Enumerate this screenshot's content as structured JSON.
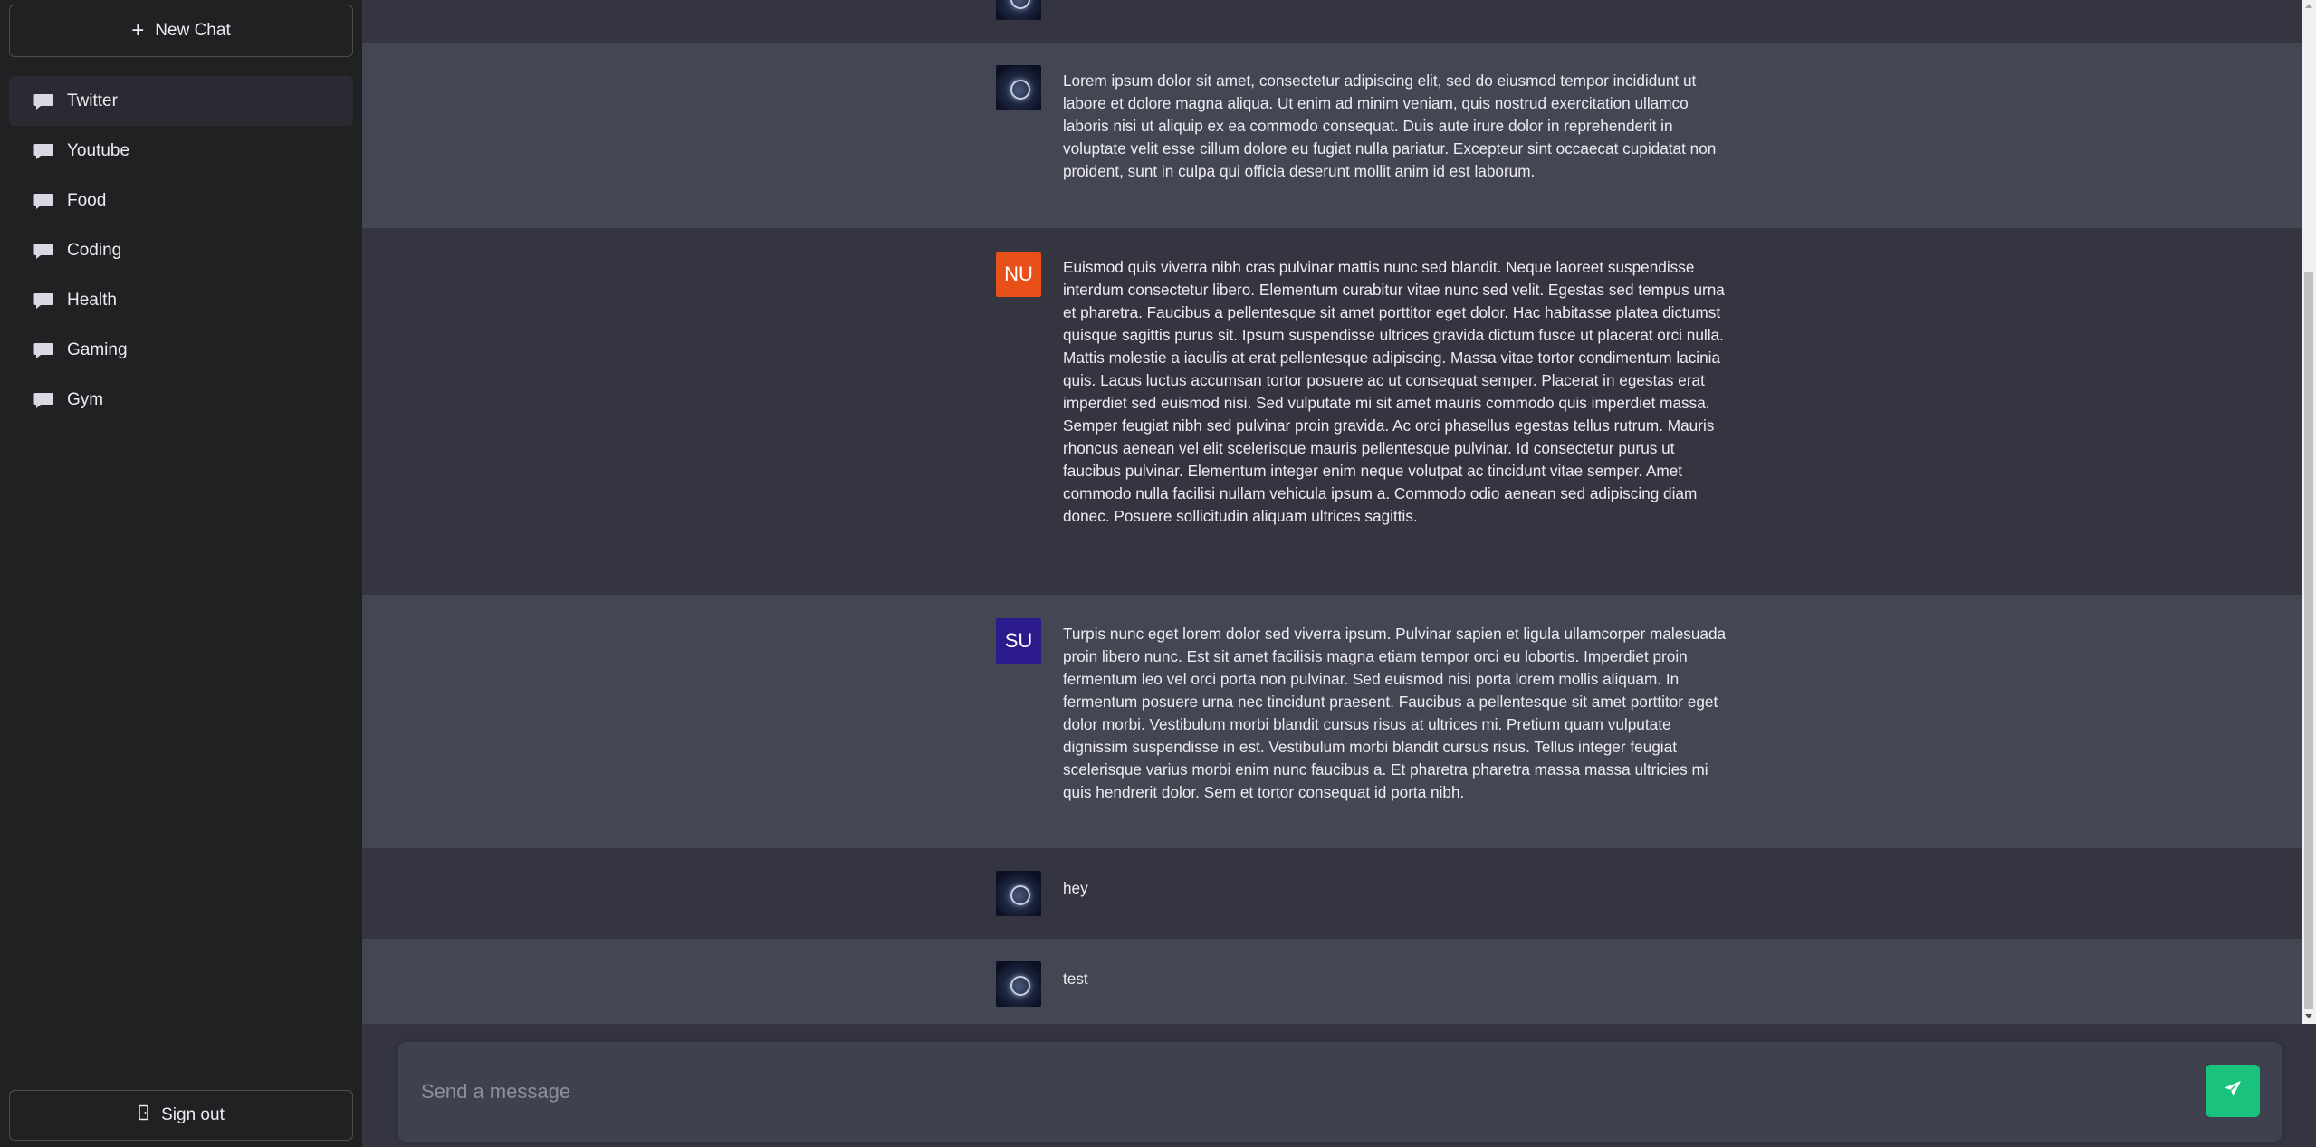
{
  "sidebar": {
    "new_chat_label": "New Chat",
    "items": [
      {
        "label": "Twitter"
      },
      {
        "label": "Youtube"
      },
      {
        "label": "Food"
      },
      {
        "label": "Coding"
      },
      {
        "label": "Health"
      },
      {
        "label": "Gaming"
      },
      {
        "label": "Gym"
      }
    ],
    "sign_out_label": "Sign out"
  },
  "messages": [
    {
      "avatar": "",
      "avatar_type": "image",
      "text": ""
    },
    {
      "avatar": "",
      "avatar_type": "image",
      "text": "Lorem ipsum dolor sit amet, consectetur adipiscing elit, sed do eiusmod tempor incididunt ut labore et dolore magna aliqua. Ut enim ad minim veniam, quis nostrud exercitation ullamco laboris nisi ut aliquip ex ea commodo consequat. Duis aute irure dolor in reprehenderit in voluptate velit esse cillum dolore eu fugiat nulla pariatur. Excepteur sint occaecat cupidatat non proident, sunt in culpa qui officia deserunt mollit anim id est laborum."
    },
    {
      "avatar": "NU",
      "avatar_type": "initials",
      "text": "Euismod quis viverra nibh cras pulvinar mattis nunc sed blandit. Neque laoreet suspendisse interdum consectetur libero. Elementum curabitur vitae nunc sed velit. Egestas sed tempus urna et pharetra. Faucibus a pellentesque sit amet porttitor eget dolor. Hac habitasse platea dictumst quisque sagittis purus sit. Ipsum suspendisse ultrices gravida dictum fusce ut placerat orci nulla. Mattis molestie a iaculis at erat pellentesque adipiscing. Massa vitae tortor condimentum lacinia quis. Lacus luctus accumsan tortor posuere ac ut consequat semper. Placerat in egestas erat imperdiet sed euismod nisi. Sed vulputate mi sit amet mauris commodo quis imperdiet massa. Semper feugiat nibh sed pulvinar proin gravida. Ac orci phasellus egestas tellus rutrum. Mauris rhoncus aenean vel elit scelerisque mauris pellentesque pulvinar. Id consectetur purus ut faucibus pulvinar. Elementum integer enim neque volutpat ac tincidunt vitae semper. Amet commodo nulla facilisi nullam vehicula ipsum a. Commodo odio aenean sed adipiscing diam donec. Posuere sollicitudin aliquam ultrices sagittis."
    },
    {
      "avatar": "SU",
      "avatar_type": "initials",
      "text": "Turpis nunc eget lorem dolor sed viverra ipsum. Pulvinar sapien et ligula ullamcorper malesuada proin libero nunc. Est sit amet facilisis magna etiam tempor orci eu lobortis. Imperdiet proin fermentum leo vel orci porta non pulvinar. Sed euismod nisi porta lorem mollis aliquam. In fermentum posuere urna nec tincidunt praesent. Faucibus a pellentesque sit amet porttitor eget dolor morbi. Vestibulum morbi blandit cursus risus at ultrices mi. Pretium quam vulputate dignissim suspendisse in est. Vestibulum morbi blandit cursus risus. Tellus integer feugiat scelerisque varius morbi enim nunc faucibus a. Et pharetra pharetra massa massa ultricies mi quis hendrerit dolor. Sem et tortor consequat id porta nibh."
    },
    {
      "avatar": "",
      "avatar_type": "image",
      "text": "hey"
    },
    {
      "avatar": "",
      "avatar_type": "image",
      "text": "test"
    }
  ],
  "composer": {
    "placeholder": "Send a message"
  },
  "colors": {
    "sidebar_bg": "#202123",
    "main_bg": "#343541",
    "alt_bg": "#444654",
    "nu_avatar": "#e8501a",
    "su_avatar": "#2a1a8c",
    "send_button": "#19c37d"
  }
}
